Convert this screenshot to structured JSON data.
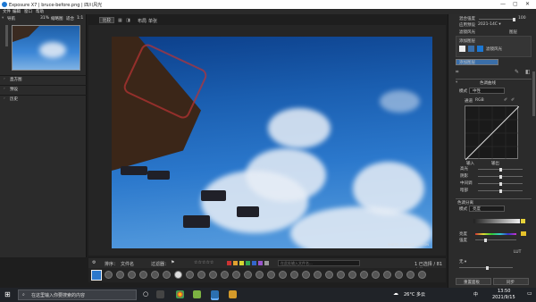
{
  "window": {
    "title": "Exposure X7 | bruce-before.png | 四川风光",
    "min": "—",
    "max": "▢",
    "close": "✕"
  },
  "menu": [
    "文件",
    "编辑",
    "窗口",
    "帮助"
  ],
  "navigator": {
    "label": "导航",
    "zoom": "31%",
    "mode": "缩略图",
    "ratio": "适合",
    "scale": "1:1"
  },
  "left_sections": [
    "直方图",
    "预设",
    "历史"
  ],
  "toolbar": {
    "view_tab": "比较",
    "compare_label": "布局",
    "style": "单张"
  },
  "watermark": "PHOTO © BRUCE COTTON",
  "filmbar": {
    "sort_label": "排序：",
    "sort_value": "文件名",
    "filter_label": "过滤器：",
    "search_placeholder": "在此处输入文件名...",
    "count": "1 已选择 / 81 文件",
    "stars": "☆☆☆☆☆"
  },
  "right": {
    "opacity_label": "混合强度",
    "opacity_value": "100",
    "preset_label": "应用预设",
    "preset_value": "2021-14C ▾",
    "sub_label": "滤镜风光",
    "sub_value": "图层",
    "layer_label": "添加图层",
    "layer_name": "滤镜风光",
    "layer_name2": "添加图层",
    "panel_curve": "色调曲线",
    "curve_mode_label": "模式",
    "curve_mode_value": "中性",
    "channel_label": "通道",
    "channel_value": "RGB",
    "input_label": "输入",
    "output_label": "输出",
    "sliders": [
      "高光",
      "阴影",
      "中间调",
      "暗部"
    ],
    "color_panel": "色调分离",
    "color_mode_label": "模式",
    "color_mode_value": "亮度",
    "highlight_label": "亮度",
    "shadow_label": "阴影",
    "amount_label": "强度",
    "lut_label": "LUT",
    "lut_value": "无 ▾",
    "reset_button": "复原",
    "apply_button": "复原",
    "bottom_left": "重置面板",
    "bottom_right": "同步"
  },
  "taskbar": {
    "search_placeholder": "在这里输入你要搜索的内容",
    "weather": "26°C 多云",
    "time": "13:50",
    "date": "2021/9/15",
    "ime": "中"
  },
  "colors": {
    "accent": "#1c77d2",
    "panel": "#2b2b2b",
    "sky": "#2b78cc"
  },
  "swatches": [
    "#cc3333",
    "#e0a030",
    "#d6d633",
    "#33aa55",
    "#3366cc",
    "#9955cc",
    "#999999"
  ]
}
